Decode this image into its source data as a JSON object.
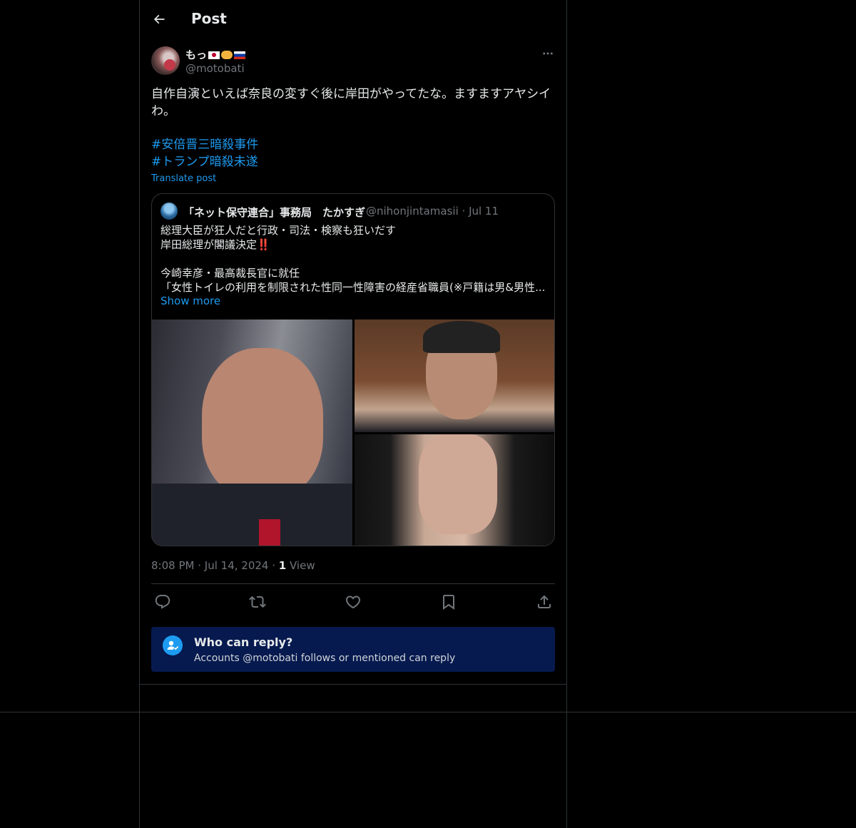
{
  "header": {
    "title": "Post"
  },
  "author": {
    "display_name": "もっ",
    "handle": "@motobati"
  },
  "post": {
    "text": "自作自演といえば奈良の変すぐ後に岸田がやってたな。ますますアヤシイわ。",
    "hashtags": [
      "#安倍晋三暗殺事件",
      "#トランプ暗殺未遂"
    ],
    "translate_label": "Translate post"
  },
  "quote": {
    "author_name": "「ネット保守連合」事務局　たかすぎ",
    "author_handle": "@nihonjintamasii",
    "date": "Jul 11",
    "lines": [
      "総理大臣が狂人だと行政・司法・検察も狂いだす",
      "岸田総理が閣議決定‼️",
      "",
      "今崎幸彦・最高裁長官に就任",
      "「女性トイレの利用を制限された性同一性障害の経産省職員(※戸籍は男&男性..."
    ],
    "show_more_label": "Show more"
  },
  "meta": {
    "time": "8:08 PM",
    "date": "Jul 14, 2024",
    "views_count": "1",
    "views_label": "View"
  },
  "reply_restriction": {
    "title": "Who can reply?",
    "subtitle": "Accounts @motobati follows or mentioned can reply"
  },
  "colors": {
    "accent": "#1d9bf0",
    "background": "#000000",
    "border": "#2f3336",
    "muted": "#71767b",
    "notice_bg": "#061a4f"
  },
  "icons": [
    "back-arrow-icon",
    "more-icon",
    "reply-icon",
    "repost-icon",
    "like-icon",
    "bookmark-icon",
    "share-icon",
    "person-check-icon"
  ]
}
